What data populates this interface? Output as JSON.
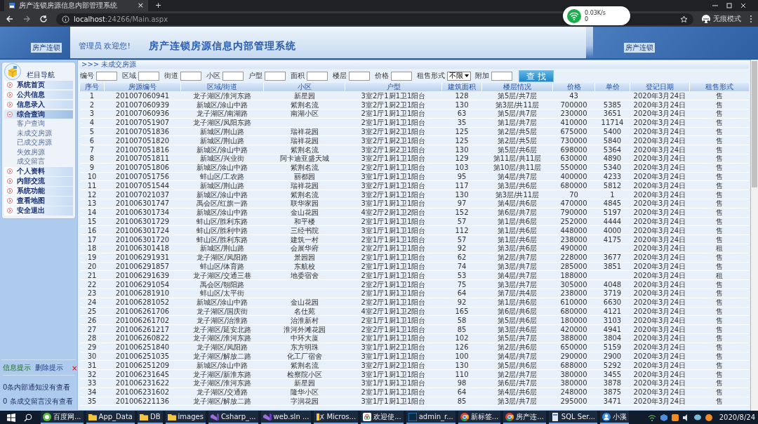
{
  "browser": {
    "tab_title": "房产连锁房源信息内部管理系统",
    "tab_close": "×",
    "new_tab": "+",
    "url_host": "localhost",
    "url_path": ":24266/Main.aspx",
    "net_speed": "0.03K/s",
    "net_count": "0",
    "profile": "无痕模式"
  },
  "header": {
    "logo_text": "房产连锁",
    "welcome": "管理员 欢迎您!",
    "title": "房产连锁房源信息内部管理系统",
    "logo_text_right": "房产连锁"
  },
  "sidebar": {
    "title": "栏目导航",
    "items": [
      {
        "label": "系统首页",
        "expanded": false
      },
      {
        "label": "公共信息",
        "expanded": false
      },
      {
        "label": "信息录入",
        "expanded": false
      },
      {
        "label": "综合查询",
        "expanded": true,
        "children": [
          {
            "label": "客户查询"
          },
          {
            "label": "未成交房源"
          },
          {
            "label": "已成交房源"
          },
          {
            "label": "失效房源"
          },
          {
            "label": "成交留言"
          }
        ]
      },
      {
        "label": "个人资料",
        "expanded": false
      },
      {
        "label": "内部交流",
        "expanded": false
      },
      {
        "label": "系统功能",
        "expanded": false
      },
      {
        "label": "查看地图",
        "expanded": false
      },
      {
        "label": "安全退出",
        "expanded": false
      }
    ],
    "notice": {
      "tabs": [
        {
          "label": "信息提示",
          "selected": true
        },
        {
          "label": "删除提示",
          "selected": false
        }
      ],
      "close": "×",
      "lines": [
        "0条内部通知没有查看",
        "0 条成交留言没有查看"
      ]
    }
  },
  "breadcrumb": ">>> 未成交房源",
  "search": {
    "fields": [
      {
        "label": "编号",
        "kind": "text"
      },
      {
        "label": "区域",
        "kind": "text"
      },
      {
        "label": "街道",
        "kind": "text"
      },
      {
        "label": "小区",
        "kind": "text"
      },
      {
        "label": "户型",
        "kind": "text"
      },
      {
        "label": "面积",
        "kind": "text"
      },
      {
        "label": "楼层",
        "kind": "text"
      },
      {
        "label": "价格",
        "kind": "text"
      },
      {
        "label": "租售形式",
        "kind": "select",
        "value": "不限"
      },
      {
        "label": "附加",
        "kind": "text"
      }
    ],
    "button": "查 找"
  },
  "table": {
    "columns": [
      "序号",
      "房源编号",
      "区域/街道",
      "小区",
      "户型",
      "建筑面积",
      "楼层情况",
      "价格",
      "单价",
      "登记日期",
      "租售形式"
    ],
    "rows": [
      [
        "1",
        "201007060941",
        "龙子湖区/淮河东路",
        "新星园",
        "3室2厅1厨1卫1阳台",
        "128",
        "第5层/共7层",
        "43",
        null,
        "2020年3月24日",
        "售"
      ],
      [
        "2",
        "201007060939",
        "新城区/涂山中路",
        "紫荆名流",
        "3室2厅1厨2卫1阳台",
        "130",
        "第3层/共11层",
        "700000",
        "5385",
        "2020年3月24日",
        "售"
      ],
      [
        "3",
        "201007060936",
        "龙子湖区/南湖路",
        "南湖小区",
        "2室1厅1厨1卫1阳台",
        "63",
        "第5层/共7层",
        "230000",
        "3651",
        "2020年3月24日",
        "售"
      ],
      [
        "4",
        "201007051907",
        "龙子湖区/凤阳东路",
        null,
        "2室1厅1厨1卫1阳台",
        "35",
        "第1层/共7层",
        "410000",
        "11714",
        "2020年3月24日",
        "售"
      ],
      [
        "5",
        "201007051836",
        "新城区/荆山路",
        "瑞祥花园",
        "3室2厅1厨2卫1阳台",
        "125",
        "第2层/共5层",
        "675000",
        "5400",
        "2020年3月24日",
        "售"
      ],
      [
        "6",
        "201007051820",
        "新城区/荆山路",
        "瑞祥花园",
        "3室2厅1厨2卫1阳台",
        "125",
        "第2层/共5层",
        "730000",
        "5840",
        "2020年3月24日",
        "售"
      ],
      [
        "7",
        "201007051816",
        "新城区/涂山中路",
        "紫荆名流",
        "3室2厅1厨2卫1阳台",
        "130",
        "第5层/共6层",
        "698000",
        "5364",
        "2020年3月24日",
        "售"
      ],
      [
        "8",
        "201007051811",
        "新城区/兴业街",
        "阿卡迪亚盛天城",
        "3室2厅1厨1卫1阳台",
        "129",
        "第11层/共11层",
        "630000",
        "4890",
        "2020年3月24日",
        "售"
      ],
      [
        "9",
        "201007051806",
        "新城区/涂山中路",
        "紫荆名流",
        "2室2厅1厨1卫1阳台",
        "103",
        "第10层/共11层",
        "550000",
        "5340",
        "2020年3月24日",
        "售"
      ],
      [
        "10",
        "201007051756",
        "蚌山区/工农路",
        "丽都园",
        "3室1厅1厨1卫1阳台",
        "95",
        "第4层/共7层",
        "400000",
        "4233",
        "2020年3月24日",
        "售"
      ],
      [
        "11",
        "201007051544",
        "新城区/荆山路",
        "瑞祥花园",
        "3室2厅1厨1卫1阳台",
        "117",
        "第3层/共6层",
        "680000",
        "5812",
        "2020年3月24日",
        "售"
      ],
      [
        "12",
        "201007021037",
        "新城区/涂山中路",
        "紫荆名流",
        "3室2厅1厨1卫1阳台",
        "130",
        "第3层/共11层",
        "70",
        "1",
        "2020年3月24日",
        "售"
      ],
      [
        "13",
        "201006301747",
        "禹会区/红旗一路",
        "联华家园",
        "3室1厅1厨1卫1阳台",
        "97",
        "第4层/共6层",
        "470000",
        "4845",
        "2020年3月24日",
        "售"
      ],
      [
        "14",
        "201006301734",
        "新城区/涂山中路",
        "金山花园",
        "4室2厅2厨1卫2阳台",
        "152",
        "第6层/共7层",
        "790000",
        "5197",
        "2020年3月24日",
        "售"
      ],
      [
        "15",
        "201006301729",
        "蚌山区/胜利东路",
        "和平楼",
        "2室1厅1厨1卫1阳台",
        "57",
        "第1层/共6层",
        "252000",
        "4444",
        "2020年3月24日",
        "售"
      ],
      [
        "16",
        "201006301724",
        "蚌山区/胜利中路",
        "三经书院",
        "3室1厅1厨1卫1阳台",
        "112",
        "第1层/共6层",
        "448000",
        "4000",
        "2020年3月24日",
        "售"
      ],
      [
        "17",
        "201006301720",
        "蚌山区/胜利东路",
        "建筑一村",
        "2室1厅1厨1卫1阳台",
        "57",
        "第1层/共6层",
        "238000",
        "4175",
        "2020年3月24日",
        "售"
      ],
      [
        "18",
        "201006301418",
        "新城区/荆山路",
        "会展华府",
        "2室2厅1厨1卫1阳台",
        "92",
        "第3层/共6层",
        "490000",
        null,
        "2020年3月24日",
        "租"
      ],
      [
        "19",
        "201006291931",
        "龙子湖区/凤阳路",
        "景园园",
        "2室1厅1厨1卫1阳台",
        "62",
        "第2层/共7层",
        "228000",
        "3677",
        "2020年3月24日",
        "售"
      ],
      [
        "20",
        "201006291857",
        "蚌山区/体育路",
        "东航校",
        "2室1厅1厨1卫1阳台",
        "74",
        "第3层/共7层",
        "285000",
        "3851",
        "2020年3月24日",
        "售"
      ],
      [
        "21",
        "201006291639",
        "龙子湖区/交通三巷",
        "地委宿舍",
        "2室1厅1厨1卫1阳台",
        "53",
        "第4层/共7层",
        "188000",
        null,
        "2020年3月24日",
        "租"
      ],
      [
        "22",
        "201006291054",
        "禹会区/朝阳路",
        null,
        "2室2厅1厨1卫1阳台",
        "75",
        "第3层/共7层",
        "305000",
        "4048",
        "2020年3月24日",
        "售"
      ],
      [
        "23",
        "201006281910",
        "蚌山区/太平街",
        null,
        "2室1厅1厨1卫1阳台",
        "64",
        "第7层/共4层",
        "238000",
        "3719",
        "2020年3月24日",
        "售"
      ],
      [
        "24",
        "201006281052",
        "新城区/涂山中路",
        "金山花园",
        "2室2厅1厨1卫1阳台",
        "92",
        "第1层/共6层",
        "610000",
        "6630",
        "2020年3月24日",
        "售"
      ],
      [
        "25",
        "201006261706",
        "龙子湖区/国庆街",
        "名仕苑",
        "4室2厅1厨1卫2阳台",
        "165",
        "第6层/共6层",
        "680000",
        "4121",
        "2020年3月24日",
        "售"
      ],
      [
        "26",
        "201006261702",
        "龙子湖区/治淮路",
        "治淮新村",
        "2室1厅1厨1卫1阳台",
        "58",
        "第5层/共6层",
        "180000",
        "3103",
        "2020年3月24日",
        "售"
      ],
      [
        "27",
        "201006261217",
        "龙子湖区/延安北路",
        "淮河外滩花园",
        "2室2厅1厨1卫1阳台",
        "85",
        "第3层/共6层",
        "420000",
        "4941",
        "2020年3月24日",
        "售"
      ],
      [
        "28",
        "201006260822",
        "龙子湖区/淮河东路",
        "中环大厦",
        "2室1厅1厨1卫1阳台",
        "102",
        "第5层/共7层",
        "388000",
        "3804",
        "2020年3月24日",
        "售"
      ],
      [
        "29",
        "201006251840",
        "龙子湖区/凤阳路",
        "东方明珠",
        "3室1厅1厨2卫1阳台",
        "126",
        "第2层/共6层",
        "650000",
        "5159",
        "2020年3月24日",
        "售"
      ],
      [
        "30",
        "201006251035",
        "龙子湖区/解放二路",
        "化工厂宿舍",
        "3室1厅1厨1卫1阳台",
        "100",
        "第4层/共7层",
        "290000",
        "2900",
        "2020年3月24日",
        "售"
      ],
      [
        "31",
        "201006251209",
        "新城区/涂山中路",
        "紫荆名流",
        "3室2厅1厨2卫1阳台",
        "130",
        "第5层/共6层",
        "688000",
        "5292",
        "2020年3月24日",
        "售"
      ],
      [
        "32",
        "201006231645",
        "龙子湖区/新淮东路",
        "检察院小区",
        "3室1厅1厨1卫1阳台",
        "110",
        "第2层/共7层",
        "380000",
        "3455",
        "2020年3月24日",
        "售"
      ],
      [
        "33",
        "201006231622",
        "龙子湖区/淮河东路",
        "新星园",
        "3室1厅1厨1卫1阳台",
        "98",
        "第6层/共7层",
        "380000",
        "3878",
        "2020年3月24日",
        "售"
      ],
      [
        "34",
        "201006231602",
        "龙子湖区/交通路",
        "隆华小区",
        "2室1厅1厨1卫1阳台",
        "64",
        "第4层/共6层",
        "248000",
        "3875",
        "2020年3月24日",
        "售"
      ],
      [
        "35",
        "201006221136",
        "龙子湖区/解放二路",
        "字润花园",
        "3室1厅1厨1卫1阳台",
        "85",
        "第3层/共7层",
        "295000",
        "3471",
        "2020年3月24日",
        "售"
      ]
    ]
  },
  "taskbar": {
    "items": [
      {
        "label": "百度网...",
        "kind": "browser"
      },
      {
        "label": "App_Data",
        "kind": "folder"
      },
      {
        "label": "DB",
        "kind": "folder"
      },
      {
        "label": "images",
        "kind": "folder"
      },
      {
        "label": "Csharp_...",
        "kind": "studio"
      },
      {
        "label": "web.sln ...",
        "kind": "studio"
      },
      {
        "label": "Micros...",
        "kind": "tool"
      },
      {
        "label": "欢迎使...",
        "kind": "cloud"
      },
      {
        "label": "admin_r...",
        "kind": "photoshop"
      },
      {
        "label": "新标签...",
        "kind": "chrome"
      },
      {
        "label": "房产连...",
        "kind": "chrome"
      },
      {
        "label": "SQL Ser...",
        "kind": "database"
      },
      {
        "label": "小溪",
        "kind": "user"
      }
    ],
    "date": "2020/8/24"
  }
}
